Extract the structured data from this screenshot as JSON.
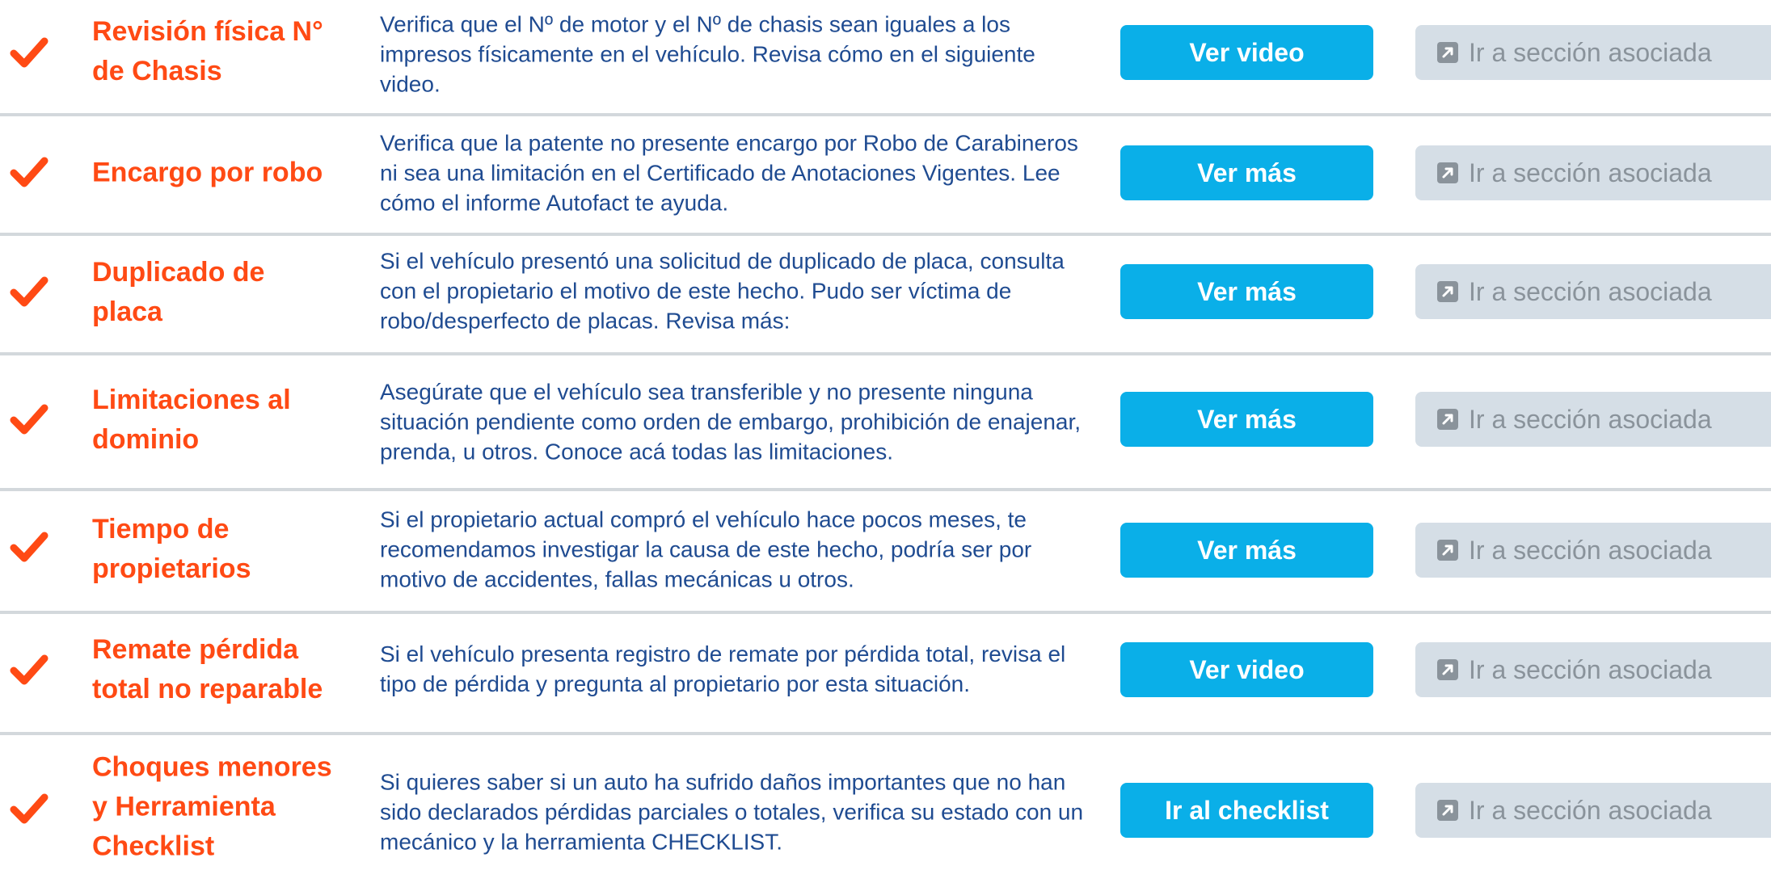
{
  "colors": {
    "accent_orange": "#ff4a14",
    "description_blue": "#1f4b91",
    "button_blue": "#0aafe8",
    "section_button_gray": "#d5dee6",
    "section_text_gray": "#8a939b",
    "divider_gray": "#d3d8dc"
  },
  "section_button_label": "Ir a sección asociada",
  "rows": [
    {
      "title": "Revisión física N° de Chasis",
      "description": "Verifica que el Nº de motor y el Nº de chasis sean iguales a los impresos físicamente en el vehículo. Revisa cómo en el siguiente video.",
      "action_label": "Ver video"
    },
    {
      "title": "Encargo por robo",
      "description": "Verifica que la patente no presente encargo por Robo de Carabineros ni sea una limitación en el Certificado de Anotaciones Vigentes. Lee cómo el informe Autofact te ayuda.",
      "action_label": "Ver más"
    },
    {
      "title": "Duplicado de placa",
      "description": "Si el vehículo presentó una solicitud de duplicado de placa, consulta con el propietario el motivo de este hecho. Pudo ser víctima de robo/desperfecto de placas. Revisa más:",
      "action_label": "Ver más"
    },
    {
      "title": "Limitaciones al dominio",
      "description": "Asegúrate que el vehículo sea transferible y no presente ninguna situación pendiente como orden de embargo, prohibición de enajenar, prenda, u otros. Conoce acá todas las limitaciones.",
      "action_label": "Ver más"
    },
    {
      "title": "Tiempo de propietarios",
      "description": "Si el propietario actual compró el vehículo hace pocos meses, te recomendamos investigar la causa de este hecho, podría ser por motivo de accidentes, fallas mecánicas u otros.",
      "action_label": "Ver más"
    },
    {
      "title": "Remate pérdida total no reparable",
      "description": "Si el vehículo presenta registro de remate por pérdida total, revisa el tipo de pérdida y pregunta al propietario por esta situación.",
      "action_label": "Ver video"
    },
    {
      "title": "Choques menores y Herramienta Checklist",
      "description": "Si quieres saber si un auto ha sufrido daños importantes que no han sido declarados pérdidas parciales o totales, verifica su estado con un mecánico y la herramienta CHECKLIST.",
      "action_label": "Ir al checklist"
    }
  ]
}
